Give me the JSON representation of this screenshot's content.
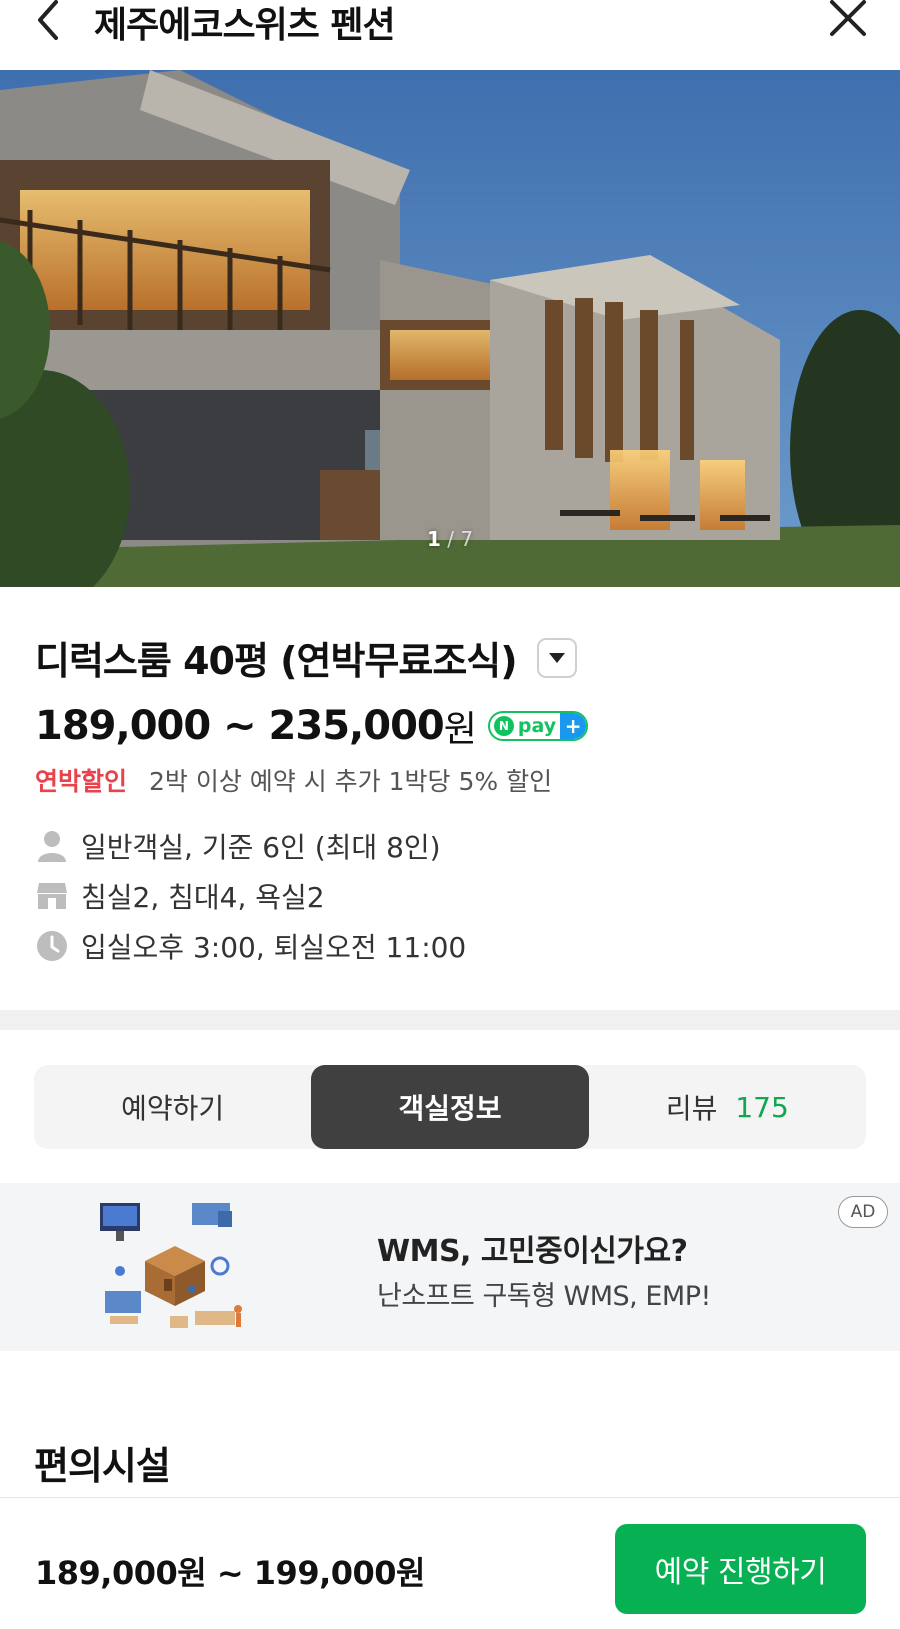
{
  "header": {
    "title": "제주에코스위츠 펜션",
    "back_icon": "chevron-left-icon",
    "close_icon": "close-icon"
  },
  "gallery": {
    "current": "1",
    "separator": " / ",
    "total": "7"
  },
  "room": {
    "title": "디럭스룸 40평 (연박무료조식)",
    "price": "189,000 ~ 235,000",
    "price_unit": "원",
    "npay": {
      "n": "N",
      "pay": "pay",
      "plus": "+"
    },
    "discount_label": "연박할인",
    "discount_text": "2박 이상 예약 시 추가 1박당 5% 할인",
    "features": [
      {
        "icon": "person-icon",
        "text": "일반객실, 기준 6인 (최대 8인)"
      },
      {
        "icon": "bed-icon",
        "text": "침실2, 침대4, 욕실2"
      },
      {
        "icon": "clock-icon",
        "text": "입실오후 3:00, 퇴실오전 11:00"
      }
    ]
  },
  "tabs": [
    {
      "label": "예약하기",
      "active": false
    },
    {
      "label": "객실정보",
      "active": true
    },
    {
      "label": "리뷰",
      "count": "175",
      "active": false
    }
  ],
  "ad": {
    "title": "WMS, 고민중이신가요?",
    "subtitle": "난소프트 구독형 WMS, EMP!",
    "badge": "AD"
  },
  "section": {
    "title": "편의시설"
  },
  "bottom": {
    "price": "189,000원 ~ 199,000원",
    "button": "예약 진행하기"
  },
  "colors": {
    "accent_green": "#07b153",
    "discount_red": "#e8424d",
    "active_tab": "#404040"
  }
}
